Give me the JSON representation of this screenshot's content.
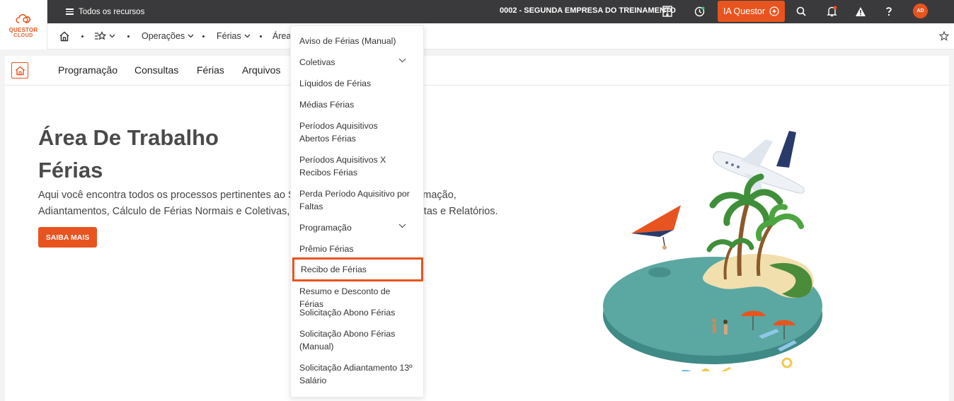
{
  "logo": {
    "line1": "QUESTOR",
    "line2": "CLOUD"
  },
  "topbar": {
    "menu_label": "Todos os recursos",
    "company": "0002 - SEGUNDA EMPRESA DO TREINAMENTO",
    "ia_label": "IA Questor",
    "avatar_initials": "AD"
  },
  "breadcrumb": {
    "items": [
      "Operações",
      "Férias",
      "Área"
    ]
  },
  "tabs": [
    "Programação",
    "Consultas",
    "Férias",
    "Arquivos"
  ],
  "hero": {
    "title_line1": "Área De Trabalho",
    "title_line2": "Férias",
    "desc_line1": "Aqui você encontra todos os processos pertinentes ao Setor de Férias, como Programação,",
    "desc_line2": "Adiantamentos, Cálculo de Férias Normais e Coletivas, além das respectivas Consultas e Relatórios.",
    "button": "SAIBA MAIS"
  },
  "dropdown": {
    "items": [
      {
        "label": "Aviso de Férias (Manual)"
      },
      {
        "label": "Coletivas",
        "has_submenu": true
      },
      {
        "label": "Líquidos de Férias"
      },
      {
        "label": "Médias Férias"
      },
      {
        "label": "Períodos Aquisitivos Abertos Férias"
      },
      {
        "label": "Períodos Aquisitivos X Recibos Férias"
      },
      {
        "label": "Perda Período Aquisitivo por Faltas"
      },
      {
        "label": "Programação",
        "has_submenu": true
      },
      {
        "label": "Prêmio Férias"
      },
      {
        "label": "Recibo de Férias",
        "highlighted": true
      },
      {
        "label": "Resumo e Desconto de Férias"
      },
      {
        "label": "Solicitação Abono Férias"
      },
      {
        "label": "Solicitação Abono Férias (Manual)"
      },
      {
        "label": "Solicitação Adiantamento 13º Salário"
      }
    ]
  },
  "colors": {
    "accent": "#e8541f",
    "topbar": "#3a3a3c",
    "sea": "#5ba7a2"
  }
}
